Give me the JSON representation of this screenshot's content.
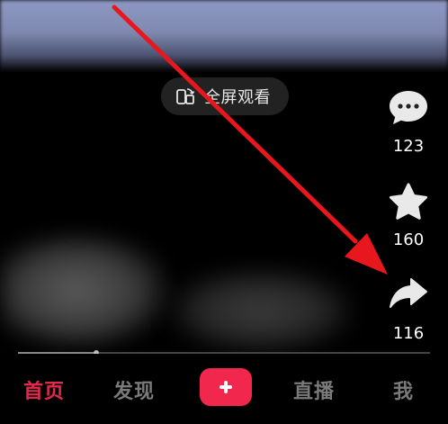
{
  "fullscreen": {
    "label": "全屏观看",
    "icon": "rotate-screen-icon"
  },
  "actions": [
    {
      "name": "comment",
      "icon": "comment-bubble-icon",
      "count": "123"
    },
    {
      "name": "favorite",
      "icon": "star-icon",
      "count": "160"
    },
    {
      "name": "share",
      "icon": "share-arrow-icon",
      "count": "116"
    }
  ],
  "progress": {
    "fraction": 0.19
  },
  "tabbar": {
    "home": "首页",
    "discover": "发现",
    "create_icon": "plus-icon",
    "live": "直播",
    "me": "我"
  },
  "colors": {
    "accent": "#f2274e",
    "active_tab": "#e32a4c",
    "annotation_arrow": "#e8171d"
  }
}
